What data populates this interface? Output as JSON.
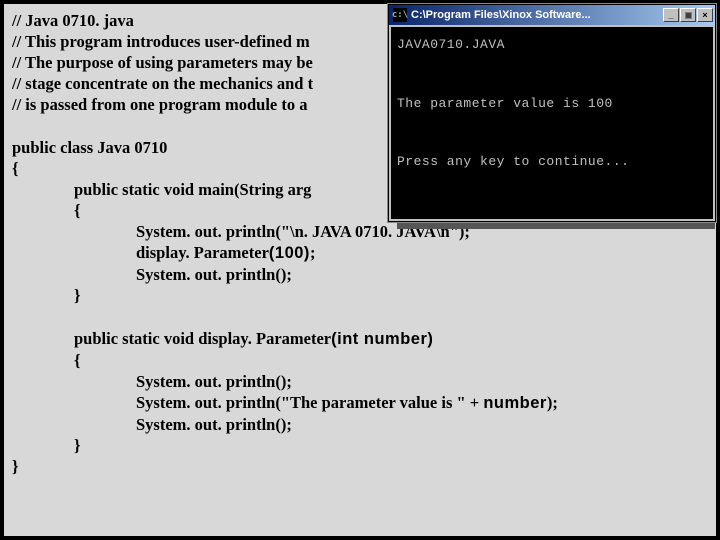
{
  "code": {
    "c1": "// Java 0710. java",
    "c2": "// This program introduces user-defined m",
    "c3": "// The purpose of using parameters may be",
    "c4": "// stage concentrate on the mechanics and t",
    "c5": "// is passed from one program module to a",
    "classline": "public class Java 0710",
    "ob": "{",
    "mainline": "public static void main(String arg",
    "ob2": "{",
    "m1": "System. out. println(\"\\n. JAVA 0710. JAVA\\n\");",
    "m2a": "display. Parameter",
    "m2b": "(100)",
    "m2c": ";",
    "m3": "System. out. println();",
    "cb2": "}",
    "dpline_a": "public static void display. Parameter",
    "dpline_b": "(int number)",
    "ob3": "{",
    "d1": "System. out. println();",
    "d2a": "System. out. println(\"The parameter value is \" + ",
    "d2b": "number",
    "d2c": ");",
    "d3": "System. out. println();",
    "cb3": "}",
    "cb": "}"
  },
  "console": {
    "title": "C:\\Program Files\\Xinox Software...",
    "icon_text": "c:\\",
    "min": "_",
    "max": "□",
    "close": "×",
    "line1": "JAVA0710.JAVA",
    "line2": "The parameter value is 100",
    "line3": "Press any key to continue..."
  }
}
